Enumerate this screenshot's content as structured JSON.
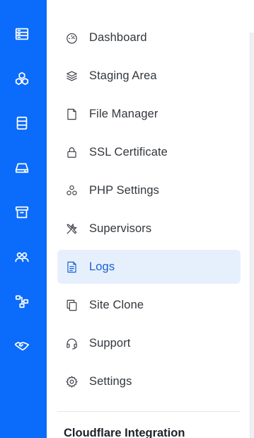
{
  "rail": {
    "icons": [
      "servers-icon",
      "packages-icon",
      "database-icon",
      "storage-drive-icon",
      "archive-icon",
      "team-icon",
      "network-icon",
      "partners-handshake-icon"
    ]
  },
  "menu": {
    "items": [
      {
        "label": "Dashboard",
        "icon": "speedometer-icon",
        "active": false
      },
      {
        "label": "Staging Area",
        "icon": "layers-icon",
        "active": false
      },
      {
        "label": "File Manager",
        "icon": "file-icon",
        "active": false
      },
      {
        "label": "SSL Certificate",
        "icon": "lock-icon",
        "active": false
      },
      {
        "label": "PHP Settings",
        "icon": "php-cubes-icon",
        "active": false
      },
      {
        "label": "Supervisors",
        "icon": "tools-icon",
        "active": false
      },
      {
        "label": "Logs",
        "icon": "document-lines-icon",
        "active": true
      },
      {
        "label": "Site Clone",
        "icon": "copy-icon",
        "active": false
      },
      {
        "label": "Support",
        "icon": "headset-icon",
        "active": false
      },
      {
        "label": "Settings",
        "icon": "gear-icon",
        "active": false
      }
    ]
  },
  "section": {
    "title": "Cloudflare Integration"
  },
  "colors": {
    "rail": "#0b6bfa",
    "active_bg": "#e6f0fd",
    "active_text": "#1a5fd6",
    "text": "#33373c"
  }
}
